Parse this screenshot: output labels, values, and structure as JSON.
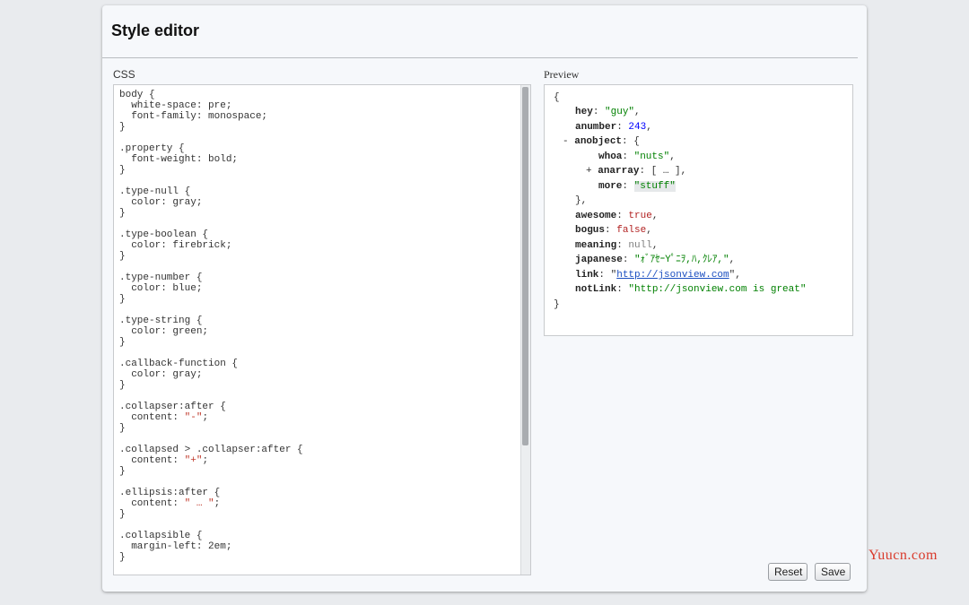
{
  "panel": {
    "title": "Style editor",
    "css_label": "CSS",
    "preview_label": "Preview"
  },
  "css_editor": {
    "lines": [
      "body {",
      "  white-space: pre;",
      "  font-family: monospace;",
      "}",
      "",
      ".property {",
      "  font-weight: bold;",
      "}",
      "",
      ".type-null {",
      "  color: gray;",
      "}",
      "",
      ".type-boolean {",
      "  color: firebrick;",
      "}",
      "",
      ".type-number {",
      "  color: blue;",
      "}",
      "",
      ".type-string {",
      "  color: green;",
      "}",
      "",
      ".callback-function {",
      "  color: gray;",
      "}",
      "",
      ".collapser:after {",
      "  content: \"-\";",
      "}",
      "",
      ".collapsed > .collapser:after {",
      "  content: \"+\";",
      "}",
      "",
      ".ellipsis:after {",
      "  content: \" … \";",
      "}",
      "",
      ".collapsible {",
      "  margin-left: 2em;",
      "}"
    ]
  },
  "preview": {
    "open_brace": "{",
    "close_brace": "}",
    "hey_key": "hey",
    "hey_value": "\"guy\"",
    "anumber_key": "anumber",
    "anumber_value": "243",
    "anobject_collapser": "-",
    "anobject_key": "anobject",
    "anobject_open": "{",
    "whoa_key": "whoa",
    "whoa_value": "\"nuts\"",
    "anarray_collapser": "+",
    "anarray_key": "anarray",
    "anarray_value": "[ … ]",
    "more_key": "more",
    "more_value": "\"stuff\"",
    "anobject_close": "},",
    "awesome_key": "awesome",
    "awesome_value": "true",
    "bogus_key": "bogus",
    "bogus_value": "false",
    "meaning_key": "meaning",
    "meaning_value": "null",
    "japanese_key": "japanese",
    "japanese_value": "\"ｫﾞｱｾｰYﾟﾆｦ,ﾊ,ｸﾚｱ,\"",
    "link_key": "link",
    "link_value": "http://jsonview.com",
    "notlink_key": "notLink",
    "notlink_value": "\"http://jsonview.com is great\""
  },
  "buttons": {
    "reset_label": "Reset",
    "save_label": "Save"
  },
  "watermark": {
    "text": "Yuucn.com"
  }
}
